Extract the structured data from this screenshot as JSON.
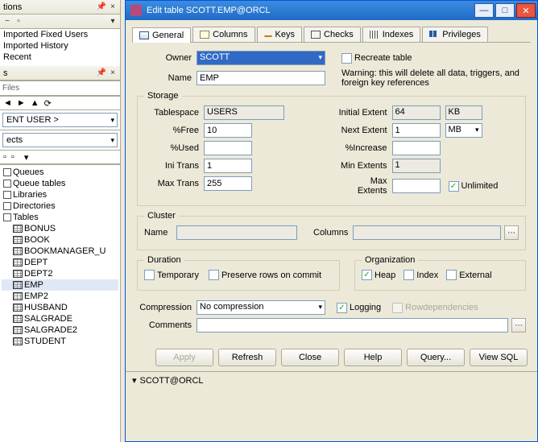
{
  "left": {
    "tions_title": "tions",
    "recent": [
      "Imported Fixed Users",
      "Imported History",
      "Recent"
    ],
    "files_label": "Files",
    "user_label": "ENT USER >",
    "ects_label": "ects",
    "categories": [
      "Queues",
      "Queue tables",
      "Libraries",
      "Directories",
      "Tables"
    ],
    "tables": [
      "BONUS",
      "BOOK",
      "BOOKMANAGER_U",
      "DEPT",
      "DEPT2",
      "EMP",
      "EMP2",
      "HUSBAND",
      "SALGRADE",
      "SALGRADE2",
      "STUDENT"
    ],
    "selected_table": "EMP"
  },
  "dlg": {
    "title": "Edit table SCOTT.EMP@ORCL",
    "tabs": [
      "General",
      "Columns",
      "Keys",
      "Checks",
      "Indexes",
      "Privileges"
    ],
    "owner_label": "Owner",
    "owner_value": "SCOTT",
    "name_label": "Name",
    "name_value": "EMP",
    "recreate_label": "Recreate table",
    "recreate_warn": "Warning: this will delete all data, triggers, and foreign key references",
    "storage": {
      "legend": "Storage",
      "tablespace_label": "Tablespace",
      "tablespace_value": "USERS",
      "pctfree_label": "%Free",
      "pctfree_value": "10",
      "pctused_label": "%Used",
      "pctused_value": "",
      "initrans_label": "Ini Trans",
      "initrans_value": "1",
      "maxtrans_label": "Max Trans",
      "maxtrans_value": "255",
      "initial_label": "Initial Extent",
      "initial_value": "64",
      "initial_unit": "KB",
      "next_label": "Next Extent",
      "next_value": "1",
      "next_unit": "MB",
      "pctinc_label": "%Increase",
      "pctinc_value": "",
      "minext_label": "Min Extents",
      "minext_value": "1",
      "maxext_label": "Max Extents",
      "unlimited_label": "Unlimited"
    },
    "cluster": {
      "legend": "Cluster",
      "name_label": "Name",
      "cols_label": "Columns"
    },
    "duration": {
      "legend": "Duration",
      "temp_label": "Temporary",
      "preserve_label": "Preserve rows on commit"
    },
    "org": {
      "legend": "Organization",
      "heap_label": "Heap",
      "index_label": "Index",
      "ext_label": "External"
    },
    "compression_label": "Compression",
    "compression_value": "No compression",
    "logging_label": "Logging",
    "rowdep_label": "Rowdependencies",
    "comments_label": "Comments",
    "btns": {
      "apply": "Apply",
      "refresh": "Refresh",
      "close": "Close",
      "help": "Help",
      "query": "Query...",
      "viewsql": "View SQL"
    },
    "status": "SCOTT@ORCL"
  }
}
